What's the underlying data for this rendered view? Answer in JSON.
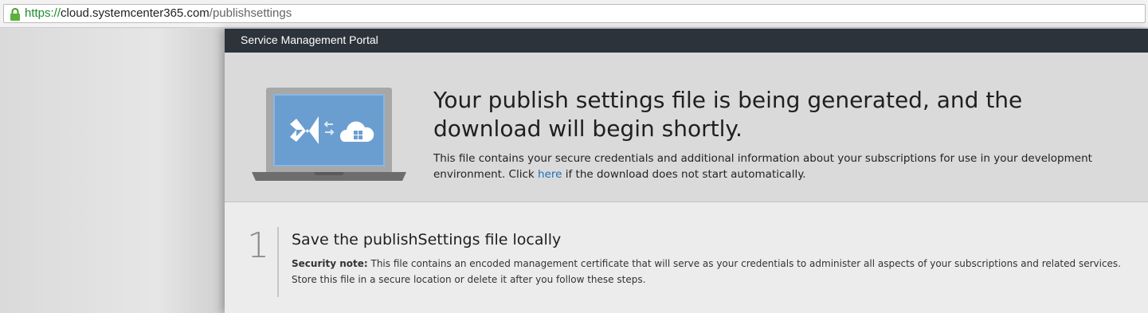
{
  "browser": {
    "url_scheme": "https://",
    "url_host": "cloud.systemcenter365.com",
    "url_path": "/publishsettings"
  },
  "header": {
    "title": "Service Management Portal"
  },
  "hero": {
    "title": "Your publish settings file is being generated, and the download will begin shortly.",
    "description_before": "This file contains your secure credentials and additional information about your subscriptions for use in your development environment. Click ",
    "link_text": "here",
    "description_after": " if the download does not start automatically."
  },
  "steps": [
    {
      "number": "1",
      "title": "Save the publishSettings file locally",
      "note_label": "Security note:",
      "note_text": " This file contains an encoded management certificate that will serve as your credentials to administer all aspects of your subscriptions and related services. Store this file in a secure location or delete it after you follow these steps."
    }
  ],
  "colors": {
    "topbar": "#2d333b",
    "link": "#1f6fb5",
    "secure_scheme": "#1f8c2e",
    "screen_blue": "#6a9ed0"
  }
}
